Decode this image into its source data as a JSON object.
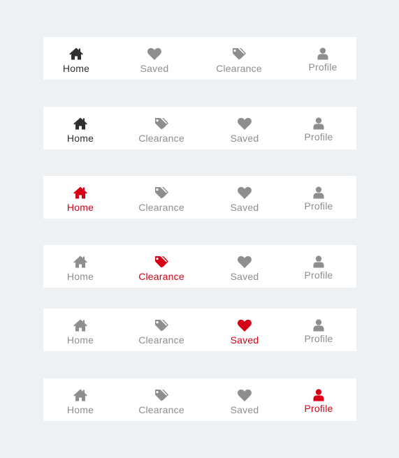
{
  "colors": {
    "inactive": "#8e8e8e",
    "dark": "#2f2f2f",
    "active_red": "#d50016",
    "background": "#edf1f4",
    "bar": "#ffffff"
  },
  "bars": [
    {
      "items": [
        {
          "label": "Home",
          "icon": "home-icon",
          "state": "dark"
        },
        {
          "label": "Saved",
          "icon": "heart-icon",
          "state": "inactive"
        },
        {
          "label": "Clearance",
          "icon": "tags-icon",
          "state": "inactive"
        },
        {
          "label": "Profile",
          "icon": "user-icon",
          "state": "inactive"
        }
      ]
    },
    {
      "items": [
        {
          "label": "Home",
          "icon": "home-icon",
          "state": "dark"
        },
        {
          "label": "Clearance",
          "icon": "tags-icon",
          "state": "inactive"
        },
        {
          "label": "Saved",
          "icon": "heart-icon",
          "state": "inactive"
        },
        {
          "label": "Profile",
          "icon": "user-icon",
          "state": "inactive"
        }
      ]
    },
    {
      "items": [
        {
          "label": "Home",
          "icon": "home-icon",
          "state": "active"
        },
        {
          "label": "Clearance",
          "icon": "tags-icon",
          "state": "inactive"
        },
        {
          "label": "Saved",
          "icon": "heart-icon",
          "state": "inactive"
        },
        {
          "label": "Profile",
          "icon": "user-icon",
          "state": "inactive"
        }
      ]
    },
    {
      "items": [
        {
          "label": "Home",
          "icon": "home-icon",
          "state": "inactive"
        },
        {
          "label": "Clearance",
          "icon": "tags-icon",
          "state": "active"
        },
        {
          "label": "Saved",
          "icon": "heart-icon",
          "state": "inactive"
        },
        {
          "label": "Profile",
          "icon": "user-icon",
          "state": "inactive"
        }
      ]
    },
    {
      "items": [
        {
          "label": "Home",
          "icon": "home-icon",
          "state": "inactive"
        },
        {
          "label": "Clearance",
          "icon": "tags-icon",
          "state": "inactive"
        },
        {
          "label": "Saved",
          "icon": "heart-icon",
          "state": "active"
        },
        {
          "label": "Profile",
          "icon": "user-icon",
          "state": "inactive"
        }
      ]
    },
    {
      "items": [
        {
          "label": "Home",
          "icon": "home-icon",
          "state": "inactive"
        },
        {
          "label": "Clearance",
          "icon": "tags-icon",
          "state": "inactive"
        },
        {
          "label": "Saved",
          "icon": "heart-icon",
          "state": "inactive"
        },
        {
          "label": "Profile",
          "icon": "user-icon",
          "state": "active"
        }
      ]
    }
  ]
}
